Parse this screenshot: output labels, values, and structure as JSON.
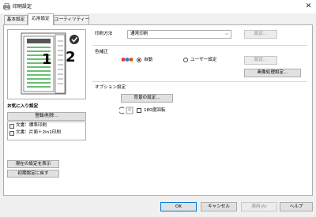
{
  "window": {
    "title": "印刷設定",
    "close_label": "✕"
  },
  "tabs": [
    {
      "label": "基本設定",
      "active": false
    },
    {
      "label": "応用設定",
      "active": true
    },
    {
      "label": "ユーティリティー",
      "active": false
    }
  ],
  "preview": {
    "page_left": "1",
    "page_right": "2"
  },
  "favorites": {
    "heading": "お気に入り設定",
    "register_button": "登録/削除...",
    "items": [
      "文書：標準印刷",
      "文書：片面＋2in1印刷"
    ]
  },
  "left_buttons": {
    "show_current": "現在の設定を表示",
    "reset": "初期設定に戻す"
  },
  "print_method": {
    "label": "印刷方法",
    "value": "通常印刷",
    "settings_button": "設定..."
  },
  "color_correction": {
    "label": "色補正",
    "auto_label": "自動",
    "user_label": "ユーザー設定",
    "selected": "auto",
    "settings_button": "設定...",
    "image_processing_button": "画像処理設定..."
  },
  "options": {
    "label": "オプション設定",
    "background_button": "背景の設定...",
    "rotate_label": "180度回転",
    "rotate_checked": false
  },
  "footer": {
    "ok": "OK",
    "cancel": "キャンセル",
    "apply": "適用(A)",
    "help": "ヘルプ"
  },
  "colors": {
    "accent": "#0078d7",
    "preview_stripes": "#3aa84a",
    "bullet": "#e05a1a"
  }
}
